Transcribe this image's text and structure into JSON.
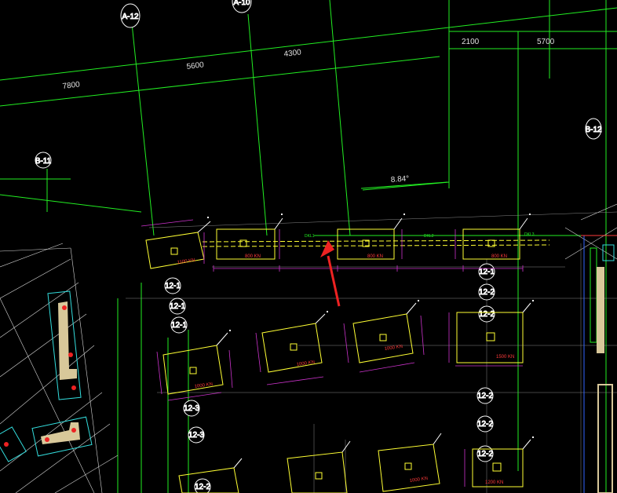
{
  "drawing": {
    "background": "#000000",
    "colors": {
      "grid": "#22ee22",
      "dim": "#ffffff",
      "footing": "#ffff33",
      "dimline": "#cc33cc",
      "label": "#ff3b3b",
      "beam": "#ffff33",
      "cyan": "#33dddd",
      "arrow": "#ee2222"
    }
  },
  "axes": {
    "a12": "A-12",
    "a10": "A-10",
    "b11": "B-11",
    "b12": "B-12",
    "d1": "12-1",
    "d2": "12-1",
    "d3": "12-1",
    "d4": "12-1",
    "d5": "12-2",
    "d6": "12-2",
    "d7": "12-2",
    "d8": "12-2",
    "d9": "12-2",
    "d10": "12-3",
    "d11": "12-3",
    "d12": "12-2"
  },
  "dimensions": {
    "d7800": "7800",
    "d5600": "5600",
    "d4300": "4300",
    "d2100": "2100",
    "d5700": "5700",
    "angle": "8.84°"
  },
  "footings": {
    "f1_load": "1100 KN",
    "f2_load": "800 KN",
    "f3_load": "800 KN",
    "f4_load": "800 KN",
    "f5_load": "1000 KN",
    "f6_load": "1000 KN",
    "f7_load": "1000 KN",
    "f8_load": "1500 KN",
    "f9_load": "1000 KN",
    "f10_load": "1200 KN"
  }
}
